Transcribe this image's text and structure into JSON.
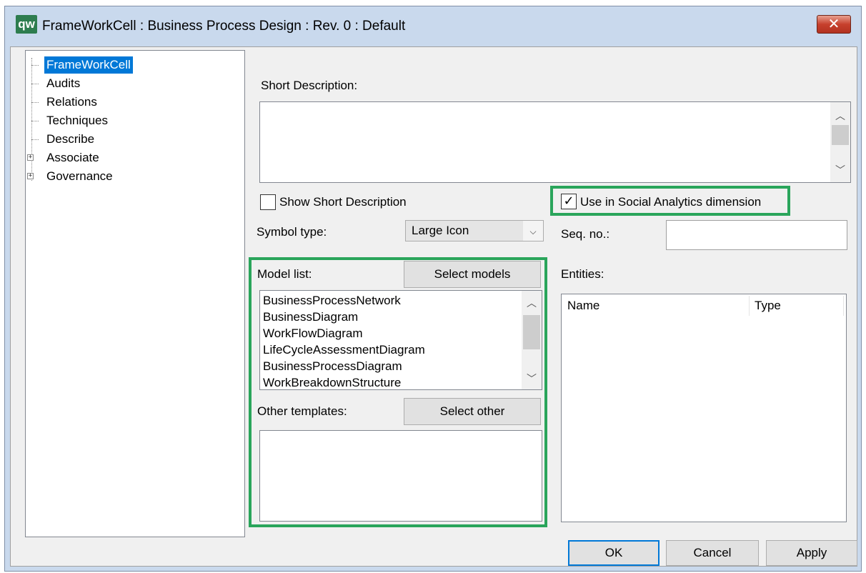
{
  "window": {
    "title": "FrameWorkCell : Business Process Design : Rev. 0  : Default",
    "app_icon_text": "qw",
    "close_glyph": "✕"
  },
  "tree": {
    "items": [
      {
        "label": "FrameWorkCell",
        "selected": true,
        "expandable": false
      },
      {
        "label": "Audits",
        "selected": false,
        "expandable": false
      },
      {
        "label": "Relations",
        "selected": false,
        "expandable": false
      },
      {
        "label": "Techniques",
        "selected": false,
        "expandable": false
      },
      {
        "label": "Describe",
        "selected": false,
        "expandable": false
      },
      {
        "label": "Associate",
        "selected": false,
        "expandable": true
      },
      {
        "label": "Governance",
        "selected": false,
        "expandable": true
      }
    ],
    "expander_glyph": "+"
  },
  "short_description": {
    "label": "Short Description:",
    "value": ""
  },
  "show_short_description": {
    "label": "Show Short Description",
    "checked": false
  },
  "social_analytics": {
    "label": "Use in Social Analytics dimension",
    "checked": true,
    "check_glyph": "✓"
  },
  "symbol_type": {
    "label": "Symbol type:",
    "value": "Large Icon",
    "chevron": "⌵"
  },
  "seq_no": {
    "label": "Seq. no.:",
    "value": ""
  },
  "model_list": {
    "label": "Model list:",
    "button": "Select models",
    "items": [
      "BusinessProcessNetwork",
      "BusinessDiagram",
      "WorkFlowDiagram",
      "LifeCycleAssessmentDiagram",
      "BusinessProcessDiagram",
      "WorkBreakdownStructure"
    ]
  },
  "other_templates": {
    "label": "Other templates:",
    "button": "Select other"
  },
  "entities": {
    "label": "Entities:",
    "columns": [
      "Name",
      "Type"
    ]
  },
  "scroll": {
    "up": "︿",
    "down": "﹀"
  },
  "footer": {
    "ok": "OK",
    "cancel": "Cancel",
    "apply": "Apply"
  },
  "colors": {
    "highlight": "#2aa55b",
    "selection": "#0078d7"
  }
}
